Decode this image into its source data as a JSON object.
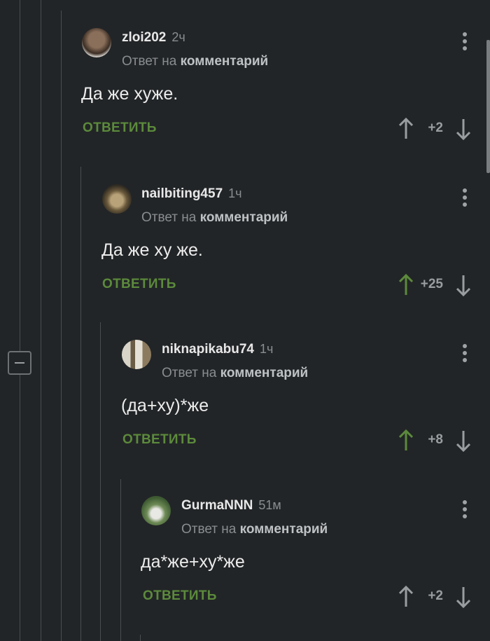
{
  "comments": [
    {
      "user": "zloi202",
      "time": "2ч",
      "reply_prefix": "Ответ на",
      "reply_link": "комментарий",
      "text": "Да же хуже.",
      "reply_label": "ОТВЕТИТЬ",
      "votes": "+2",
      "upvoted": false
    },
    {
      "user": "nailbiting457",
      "time": "1ч",
      "reply_prefix": "Ответ на",
      "reply_link": "комментарий",
      "text": "Да же ху же.",
      "reply_label": "ОТВЕТИТЬ",
      "votes": "+25",
      "upvoted": true
    },
    {
      "user": "niknapikabu74",
      "time": "1ч",
      "reply_prefix": "Ответ на",
      "reply_link": "комментарий",
      "text": "(да+ху)*же",
      "reply_label": "ОТВЕТИТЬ",
      "votes": "+8",
      "upvoted": true
    },
    {
      "user": "GurmaNNN",
      "time": "51м",
      "reply_prefix": "Ответ на",
      "reply_link": "комментарий",
      "text": "да*же+ху*же",
      "reply_label": "ОТВЕТИТЬ",
      "votes": "+2",
      "upvoted": false
    }
  ],
  "colors": {
    "accent_green": "#5c8a3c",
    "background": "#222527",
    "muted": "#8a8d90"
  },
  "icons": {
    "collapse": "collapse-minus-icon",
    "menu": "more-vertical-icon",
    "up": "arrow-up-icon",
    "down": "arrow-down-icon"
  }
}
